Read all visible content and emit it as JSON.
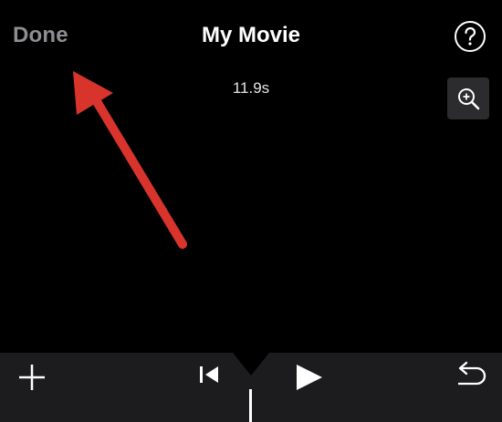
{
  "header": {
    "done_label": "Done",
    "title": "My Movie",
    "help_icon": "question-mark-circle-icon"
  },
  "timeline": {
    "duration": "11.9s",
    "zoom_icon": "zoom-in-icon"
  },
  "annotation": {
    "type": "arrow",
    "points_to": "done-button",
    "color": "#d9342b"
  },
  "toolbar": {
    "add_icon": "plus-icon",
    "skip_back_icon": "skip-to-start-icon",
    "play_icon": "play-icon",
    "undo_icon": "undo-icon"
  },
  "colors": {
    "background": "#000000",
    "toolbar": "#1c1c1e",
    "done_text": "#8e8e93",
    "title_text": "#ffffff",
    "zoom_button_bg": "#2c2c2e",
    "arrow": "#d9342b"
  }
}
